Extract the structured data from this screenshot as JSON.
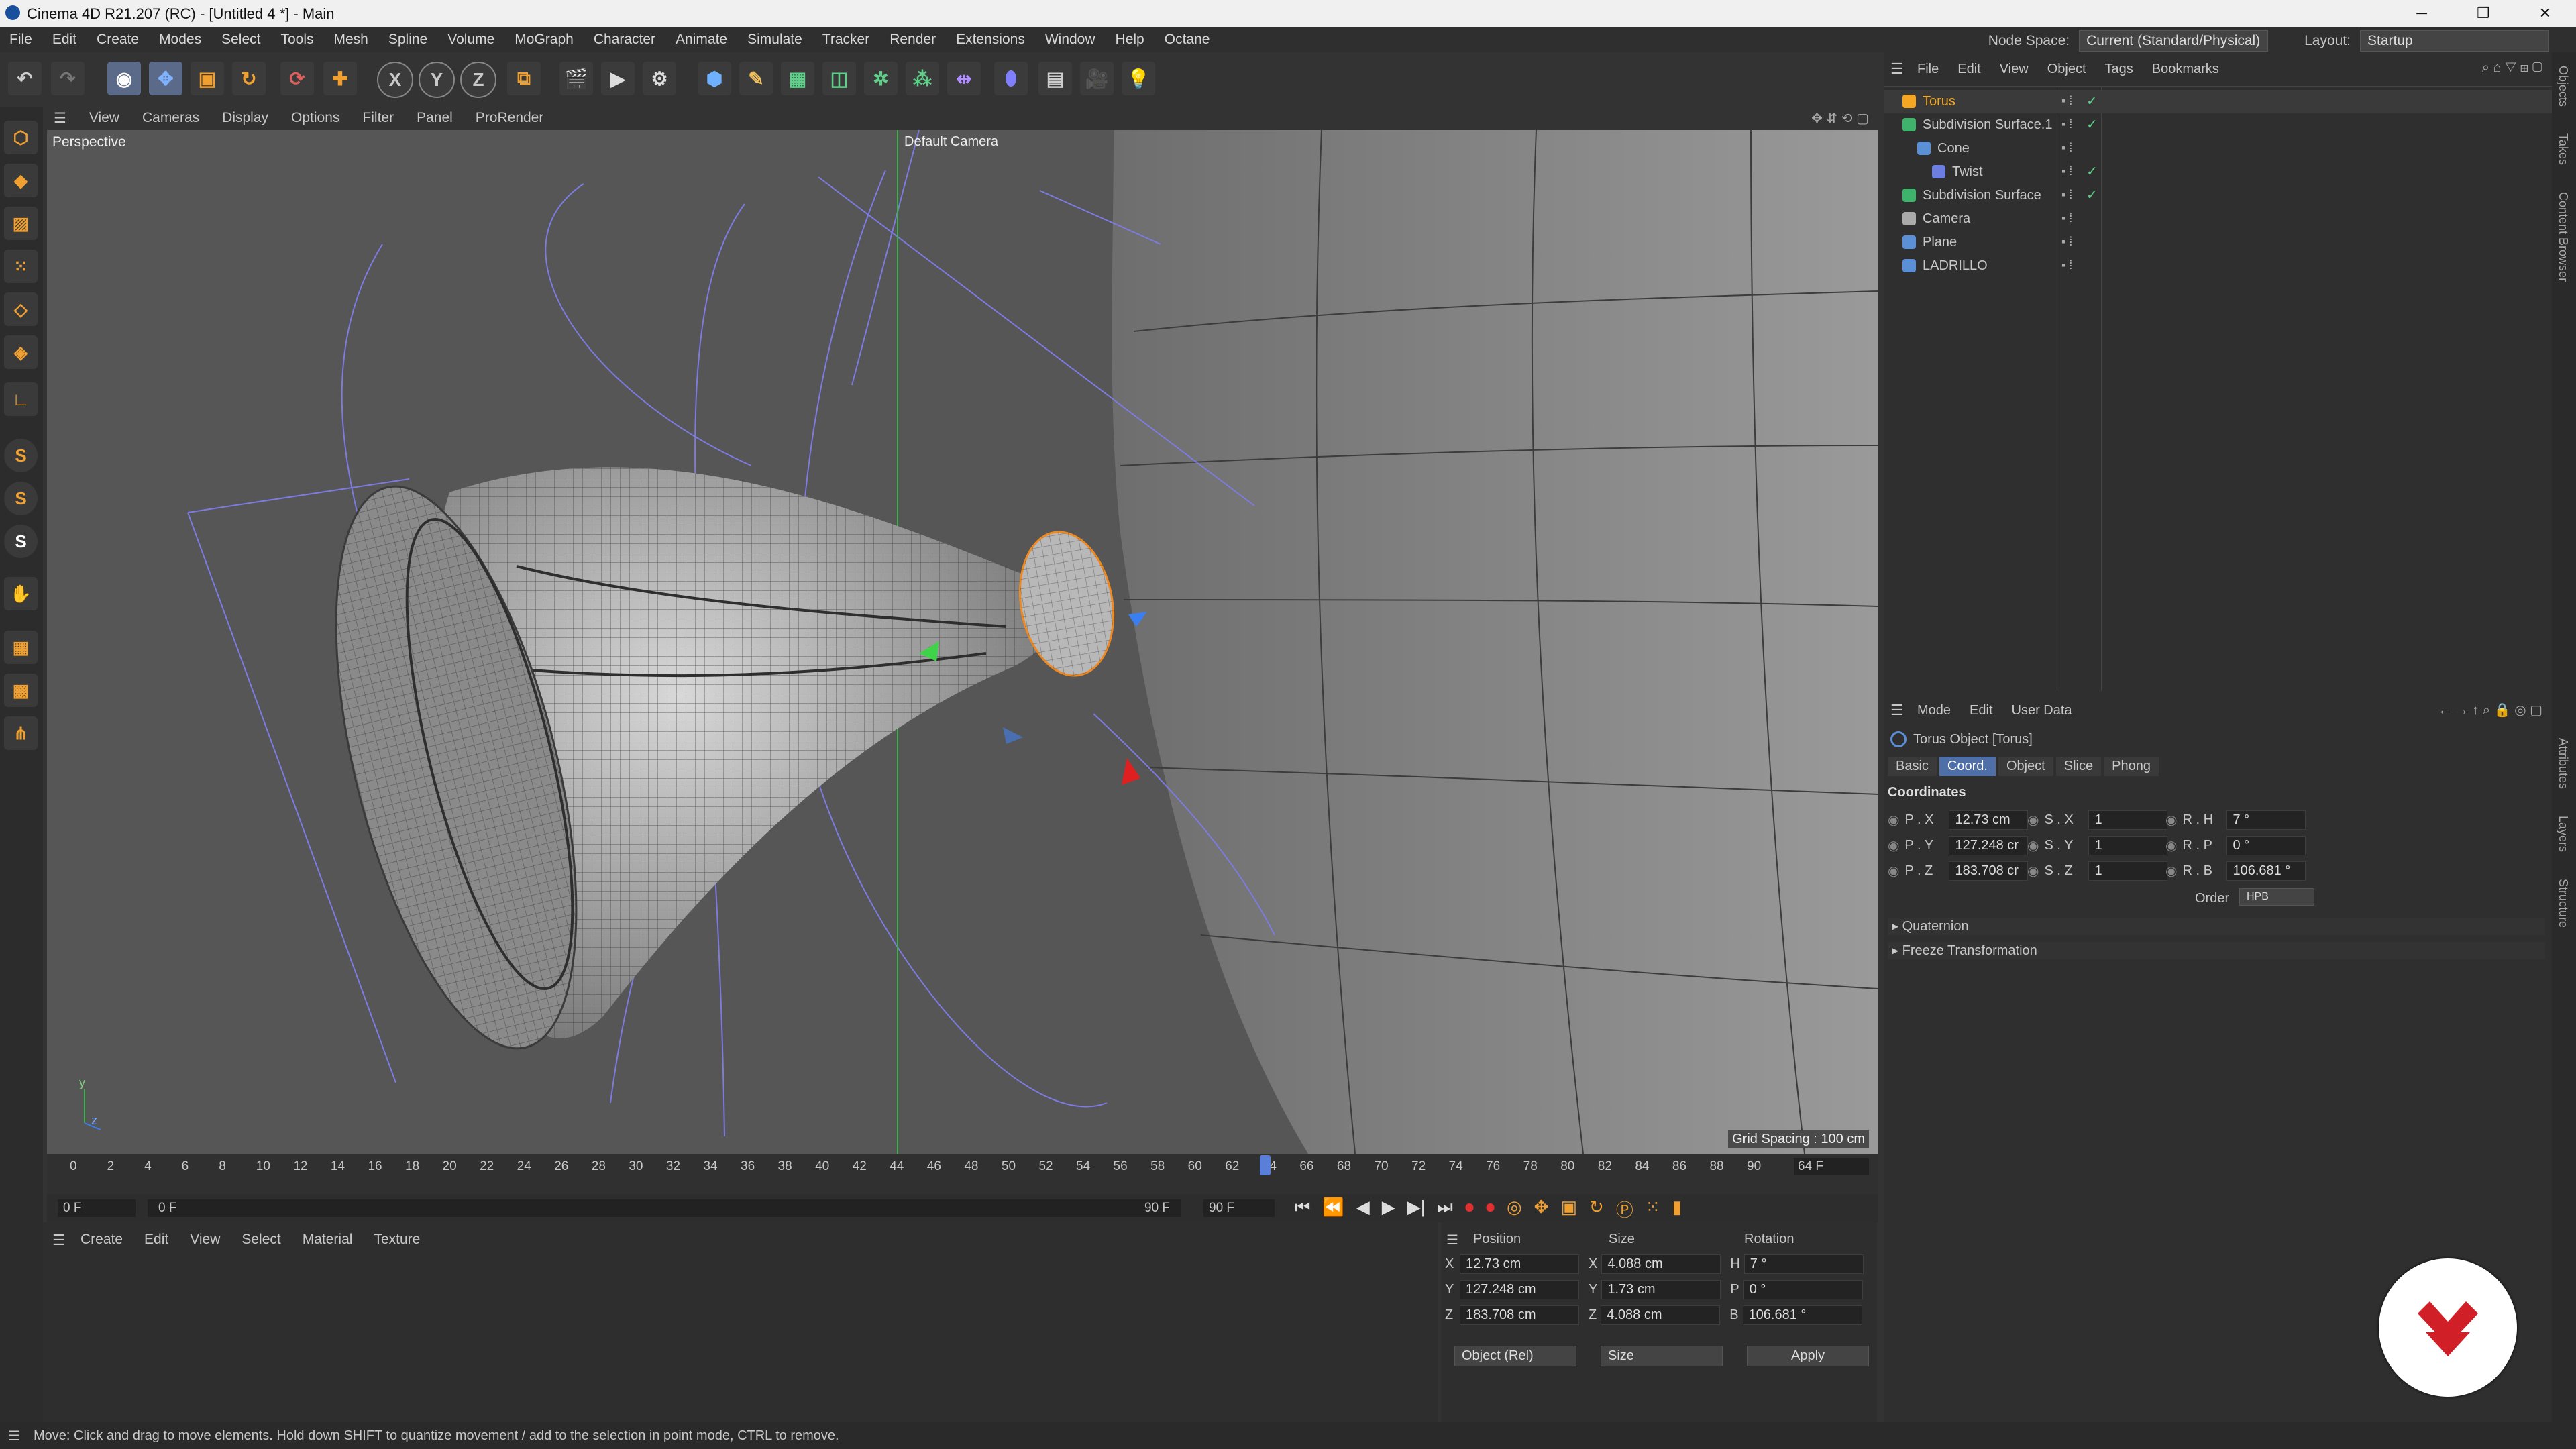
{
  "window": {
    "title": "Cinema 4D R21.207 (RC) - [Untitled 4 *] - Main",
    "min": "─",
    "max": "❐",
    "close": "✕"
  },
  "menu": [
    "File",
    "Edit",
    "Create",
    "Modes",
    "Select",
    "Tools",
    "Mesh",
    "Spline",
    "Volume",
    "MoGraph",
    "Character",
    "Animate",
    "Simulate",
    "Tracker",
    "Render",
    "Extensions",
    "Window",
    "Help",
    "Octane"
  ],
  "node_space": {
    "label": "Node Space:",
    "value": "Current (Standard/Physical)"
  },
  "layout": {
    "label": "Layout:",
    "value": "Startup"
  },
  "axis_buttons": [
    "X",
    "Y",
    "Z"
  ],
  "left_tool_letters": [
    "S",
    "S",
    "S"
  ],
  "viewport": {
    "menu": [
      "View",
      "Cameras",
      "Display",
      "Options",
      "Filter",
      "Panel",
      "ProRender"
    ],
    "label": "Perspective",
    "camera": "Default Camera",
    "grid_spacing": "Grid Spacing : 100 cm",
    "axis_y": "y",
    "axis_z": "z"
  },
  "timeline": {
    "ticks": [
      "0",
      "2",
      "4",
      "6",
      "8",
      "10",
      "12",
      "14",
      "16",
      "18",
      "20",
      "22",
      "24",
      "26",
      "28",
      "30",
      "32",
      "34",
      "36",
      "38",
      "40",
      "42",
      "44",
      "46",
      "48",
      "50",
      "52",
      "54",
      "56",
      "58",
      "60",
      "62",
      "64",
      "66",
      "68",
      "70",
      "72",
      "74",
      "76",
      "78",
      "80",
      "82",
      "84",
      "86",
      "88",
      "90"
    ],
    "current_frame": "64 F",
    "playhead_frame": 64,
    "max_frame": 90,
    "start": "0 F",
    "range_start": "0 F",
    "range_end": "90 F",
    "end": "90 F"
  },
  "material_menu": [
    "Create",
    "Edit",
    "View",
    "Select",
    "Material",
    "Texture"
  ],
  "coords": {
    "headers": [
      "Position",
      "Size",
      "Rotation"
    ],
    "rows": [
      {
        "axis": "X",
        "pos": "12.73 cm",
        "size_axis": "X",
        "size": "4.088 cm",
        "rot_axis": "H",
        "rot": "7 °"
      },
      {
        "axis": "Y",
        "pos": "127.248 cm",
        "size_axis": "Y",
        "size": "1.73 cm",
        "rot_axis": "P",
        "rot": "0 °"
      },
      {
        "axis": "Z",
        "pos": "183.708 cm",
        "size_axis": "Z",
        "size": "4.088 cm",
        "rot_axis": "B",
        "rot": "106.681 °"
      }
    ],
    "mode": "Object (Rel)",
    "size_mode": "Size",
    "apply": "Apply"
  },
  "objects": {
    "menu": [
      "File",
      "Edit",
      "View",
      "Object",
      "Tags",
      "Bookmarks"
    ],
    "items": [
      {
        "name": "Torus",
        "indent": 0,
        "color": "#f5a623",
        "active": true,
        "flags": "✓"
      },
      {
        "name": "Subdivision Surface.1",
        "indent": 0,
        "color": "#3fb36b",
        "active": false,
        "flags": "✓"
      },
      {
        "name": "Cone",
        "indent": 1,
        "color": "#5b8fd6",
        "active": false,
        "flags": ""
      },
      {
        "name": "Twist",
        "indent": 2,
        "color": "#6c7fe0",
        "active": false,
        "flags": "✓"
      },
      {
        "name": "Subdivision Surface",
        "indent": 0,
        "color": "#3fb36b",
        "active": false,
        "flags": "✓"
      },
      {
        "name": "Camera",
        "indent": 0,
        "color": "#aaaaaa",
        "active": false,
        "flags": ""
      },
      {
        "name": "Plane",
        "indent": 0,
        "color": "#5b8fd6",
        "active": false,
        "flags": ""
      },
      {
        "name": "LADRILLO",
        "indent": 0,
        "color": "#5b8fd6",
        "active": false,
        "flags": ""
      }
    ]
  },
  "attributes": {
    "menu": [
      "Mode",
      "Edit",
      "User Data"
    ],
    "title": "Torus Object [Torus]",
    "tabs": [
      "Basic",
      "Coord.",
      "Object",
      "Slice",
      "Phong"
    ],
    "active_tab": "Coord.",
    "section": "Coordinates",
    "rows": [
      {
        "p_label": "P . X",
        "p": "12.73 cm",
        "s_label": "S . X",
        "s": "1",
        "r_label": "R . H",
        "r": "7 °"
      },
      {
        "p_label": "P . Y",
        "p": "127.248 cr",
        "s_label": "S . Y",
        "s": "1",
        "r_label": "R . P",
        "r": "0 °"
      },
      {
        "p_label": "P . Z",
        "p": "183.708 cr",
        "s_label": "S . Z",
        "s": "1",
        "r_label": "R . B",
        "r": "106.681 °"
      }
    ],
    "order_label": "Order",
    "order": "HPB",
    "collapsed": [
      "Quaternion",
      "Freeze Transformation"
    ]
  },
  "side_tabs": [
    "Objects",
    "Takes",
    "Content Browser",
    "Attributes",
    "Layers",
    "Structure"
  ],
  "status": "Move: Click and drag to move elements. Hold down SHIFT to quantize movement / add to the selection in point mode, CTRL to remove."
}
